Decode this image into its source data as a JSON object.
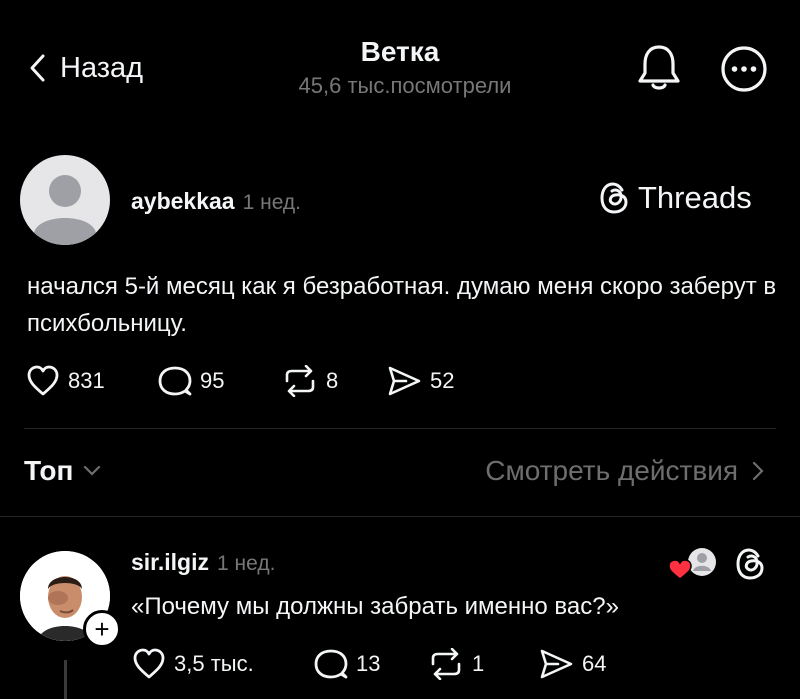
{
  "header": {
    "back_label": "Назад",
    "title": "Ветка",
    "views": "45,6 тыс.посмотрели"
  },
  "post": {
    "username": "aybekkaa",
    "time": "1 нед.",
    "brand": "Threads",
    "text": "начался 5-й месяц как я безработная. думаю меня скоро заберут в психбольницу.",
    "likes": "831",
    "comments": "95",
    "reposts": "8",
    "shares": "52"
  },
  "sort": {
    "label": "Топ",
    "activity_label": "Смотреть действия"
  },
  "reply": {
    "username": "sir.ilgiz",
    "time": "1 нед.",
    "text": "«Почему мы должны забрать именно вас?»",
    "likes": "3,5 тыс.",
    "comments": "13",
    "reposts": "1",
    "shares": "64"
  },
  "colors": {
    "background": "#000000",
    "text": "#f3f5f7",
    "secondary": "#777777",
    "like_red": "#ff3040"
  }
}
